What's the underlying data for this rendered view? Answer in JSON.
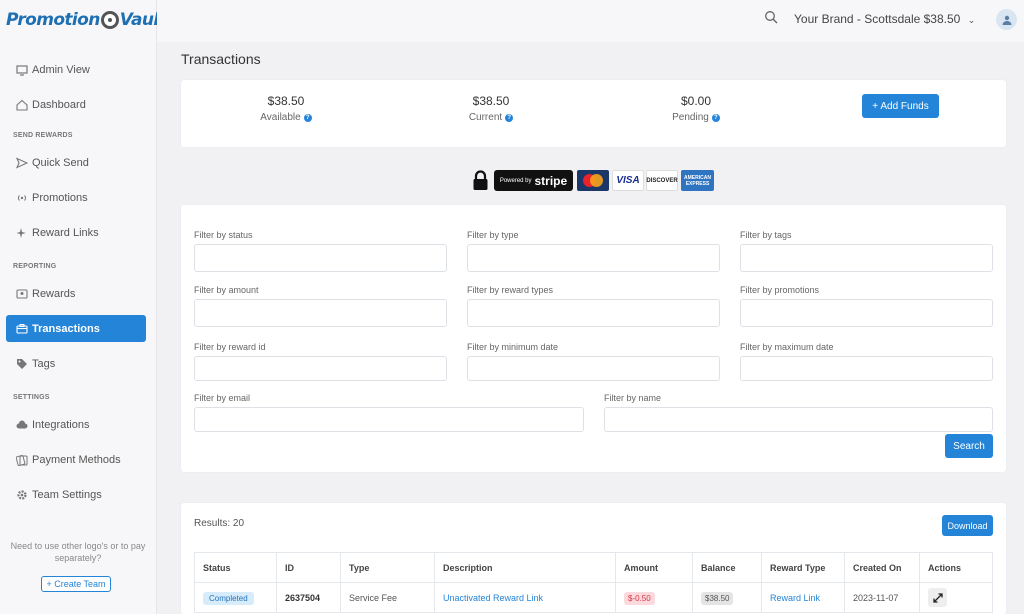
{
  "app": {
    "logo_text_1": "Promotion",
    "logo_text_2": "Vault"
  },
  "sidebar": {
    "items": [
      {
        "label": "Admin View",
        "icon": "monitor-icon"
      },
      {
        "label": "Dashboard",
        "icon": "home-icon"
      },
      {
        "label": "Quick Send",
        "icon": "send-icon"
      },
      {
        "label": "Promotions",
        "icon": "broadcast-icon"
      },
      {
        "label": "Reward Links",
        "icon": "sparkle-icon"
      },
      {
        "label": "Rewards",
        "icon": "rewards-icon"
      },
      {
        "label": "Transactions",
        "icon": "transactions-icon",
        "active": true
      },
      {
        "label": "Tags",
        "icon": "tag-icon"
      },
      {
        "label": "Integrations",
        "icon": "cloud-icon"
      },
      {
        "label": "Payment Methods",
        "icon": "cards-icon"
      },
      {
        "label": "Team Settings",
        "icon": "gear-icon"
      }
    ],
    "sections": [
      "SEND REWARDS",
      "REPORTING",
      "SETTINGS"
    ],
    "logos_note": "Need to use other logo's or to pay separately?",
    "create_team": "+ Create Team"
  },
  "header": {
    "brand": "Your Brand - Scottsdale $38.50"
  },
  "page": {
    "title": "Transactions"
  },
  "balances": {
    "available_amount": "$38.50",
    "available_label": "Available",
    "current_amount": "$38.50",
    "current_label": "Current",
    "pending_amount": "$0.00",
    "pending_label": "Pending",
    "add_funds": "+ Add Funds"
  },
  "payment": {
    "stripe_small": "Powered by",
    "stripe_big": "stripe",
    "visa": "VISA",
    "discover": "DISCOVER",
    "amex": "AMERICAN EXPRESS"
  },
  "filters": {
    "status": "Filter by status",
    "type": "Filter by type",
    "tags": "Filter by tags",
    "amount": "Filter by amount",
    "reward_types": "Filter by reward types",
    "promotions": "Filter by promotions",
    "reward_id": "Filter by reward id",
    "min_date": "Filter by minimum date",
    "max_date": "Filter by maximum date",
    "email": "Filter by email",
    "name": "Filter by name",
    "search": "Search"
  },
  "results": {
    "count": "Results: 20",
    "download": "Download",
    "columns": [
      "Status",
      "ID",
      "Type",
      "Description",
      "Amount",
      "Balance",
      "Reward Type",
      "Created On",
      "Actions"
    ],
    "rows": [
      {
        "status": "Completed",
        "id": "2637504",
        "type": "Service Fee",
        "description": "Unactivated Reward Link",
        "amount": "$-0.50",
        "balance": "$38.50",
        "reward_type": "Reward Link",
        "created_on": "2023-11-07"
      }
    ]
  },
  "colors": {
    "accent": "#2485d8",
    "brand_logo": "#1f6fb3"
  }
}
